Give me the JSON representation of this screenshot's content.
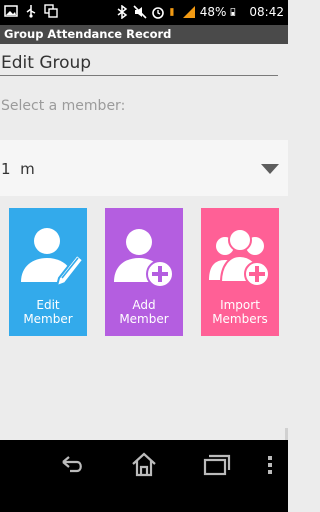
{
  "status_bar": {
    "battery": "48%",
    "time": "08:42",
    "left_icons": [
      "image-icon",
      "usb-icon",
      "copy-icon"
    ],
    "right_icons": [
      "bluetooth-icon",
      "mute-icon",
      "alarm-icon",
      "battery-icon",
      "signal-icon"
    ]
  },
  "action_bar": {
    "title": "Group Attendance Record"
  },
  "form": {
    "group_name": "Edit Group",
    "select_label": "Select a member:",
    "selected_member": "1  m"
  },
  "tiles": [
    {
      "line1": "Edit",
      "line2": "Member",
      "icon": "edit-member-icon",
      "color": "#33aaeb"
    },
    {
      "line1": "Add",
      "line2": "Member",
      "icon": "add-member-icon",
      "color": "#b45ee0"
    },
    {
      "line1": "Import",
      "line2": "Members",
      "icon": "import-members-icon",
      "color": "#ff6096"
    }
  ],
  "nav_bar": {
    "buttons": [
      "back-icon",
      "home-icon",
      "recents-icon",
      "menu-icon"
    ]
  }
}
